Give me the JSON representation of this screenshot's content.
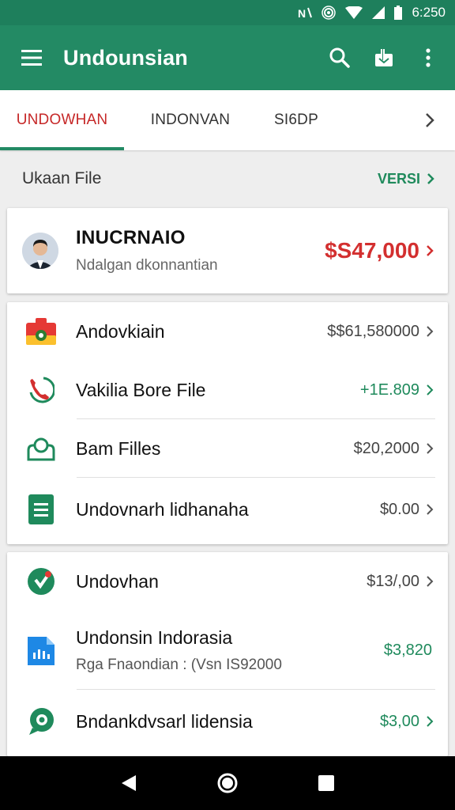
{
  "status": {
    "time": "6:250"
  },
  "appbar": {
    "title": "Undounsian"
  },
  "tabs": [
    {
      "label": "UNDOWHAN"
    },
    {
      "label": "INDONVAN"
    },
    {
      "label": "SI6DP"
    }
  ],
  "section": {
    "label": "Ukaan File",
    "link": "VERSI"
  },
  "profile": {
    "name": "INUCRNAIO",
    "subtitle": "Ndalgan dkonnantian",
    "amount": "$S47,000"
  },
  "group1": [
    {
      "label": "Andovkiain",
      "amount": "$$61,580000"
    },
    {
      "label": "Vakilia Bore File",
      "amount": "+1E.809"
    },
    {
      "label": "Bam Filles",
      "amount": "$20,2000"
    },
    {
      "label": "Undovnarh lidhanaha",
      "amount": "$0.00"
    }
  ],
  "group2": [
    {
      "label": "Undovhan",
      "amount": "$13/,00"
    },
    {
      "label": "Undonsin Indorasia",
      "subtitle": "Rga Fnaondian : (Vsn IS92000",
      "amount": "$3,820"
    },
    {
      "label": "Bndankdvsarl lidensia",
      "amount": "$3,00"
    }
  ],
  "colors": {
    "primary": "#238a64",
    "accent_red": "#d32f2f",
    "green_text": "#1f8a5c"
  },
  "icons": {
    "menu": "menu-icon",
    "search": "search-icon",
    "share": "share-icon",
    "more": "more-vert-icon"
  }
}
